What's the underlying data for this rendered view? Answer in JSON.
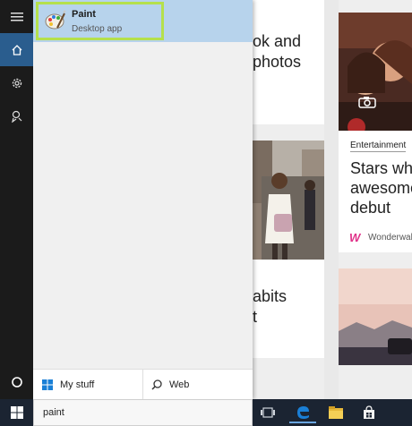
{
  "search": {
    "query": "paint"
  },
  "best_match": {
    "title": "Paint",
    "subtitle": "Desktop app",
    "icon": "paint-palette-icon"
  },
  "filters": {
    "my_stuff_label": "My stuff",
    "web_label": "Web"
  },
  "sidebar": {
    "items": [
      {
        "icon": "hamburger-menu-icon"
      },
      {
        "icon": "home-icon",
        "active": true
      },
      {
        "icon": "settings-gear-icon"
      },
      {
        "icon": "feedback-icon"
      }
    ],
    "bottom_icon": "cortana-circle-icon"
  },
  "background": {
    "card1_lines": [
      "ok and",
      "photos"
    ],
    "card2_lines": [
      "abits",
      "t"
    ],
    "feature_card": {
      "category": "Entertainment",
      "headline_lines": [
        "Stars who",
        "awesome",
        "debut"
      ],
      "source": "Wonderwall",
      "source_logo": "W"
    }
  },
  "taskbar": {
    "icons": [
      "task-view-icon",
      "edge-browser-icon",
      "file-explorer-icon",
      "store-icon"
    ]
  },
  "colors": {
    "sidebar": "#1b1b1b",
    "sidebar_active": "#2a5d8e",
    "result_highlight": "#b7d3ec",
    "result_outline": "#b5e04c",
    "taskbar": "#1b2432",
    "edge_blue": "#1a7fd6"
  }
}
